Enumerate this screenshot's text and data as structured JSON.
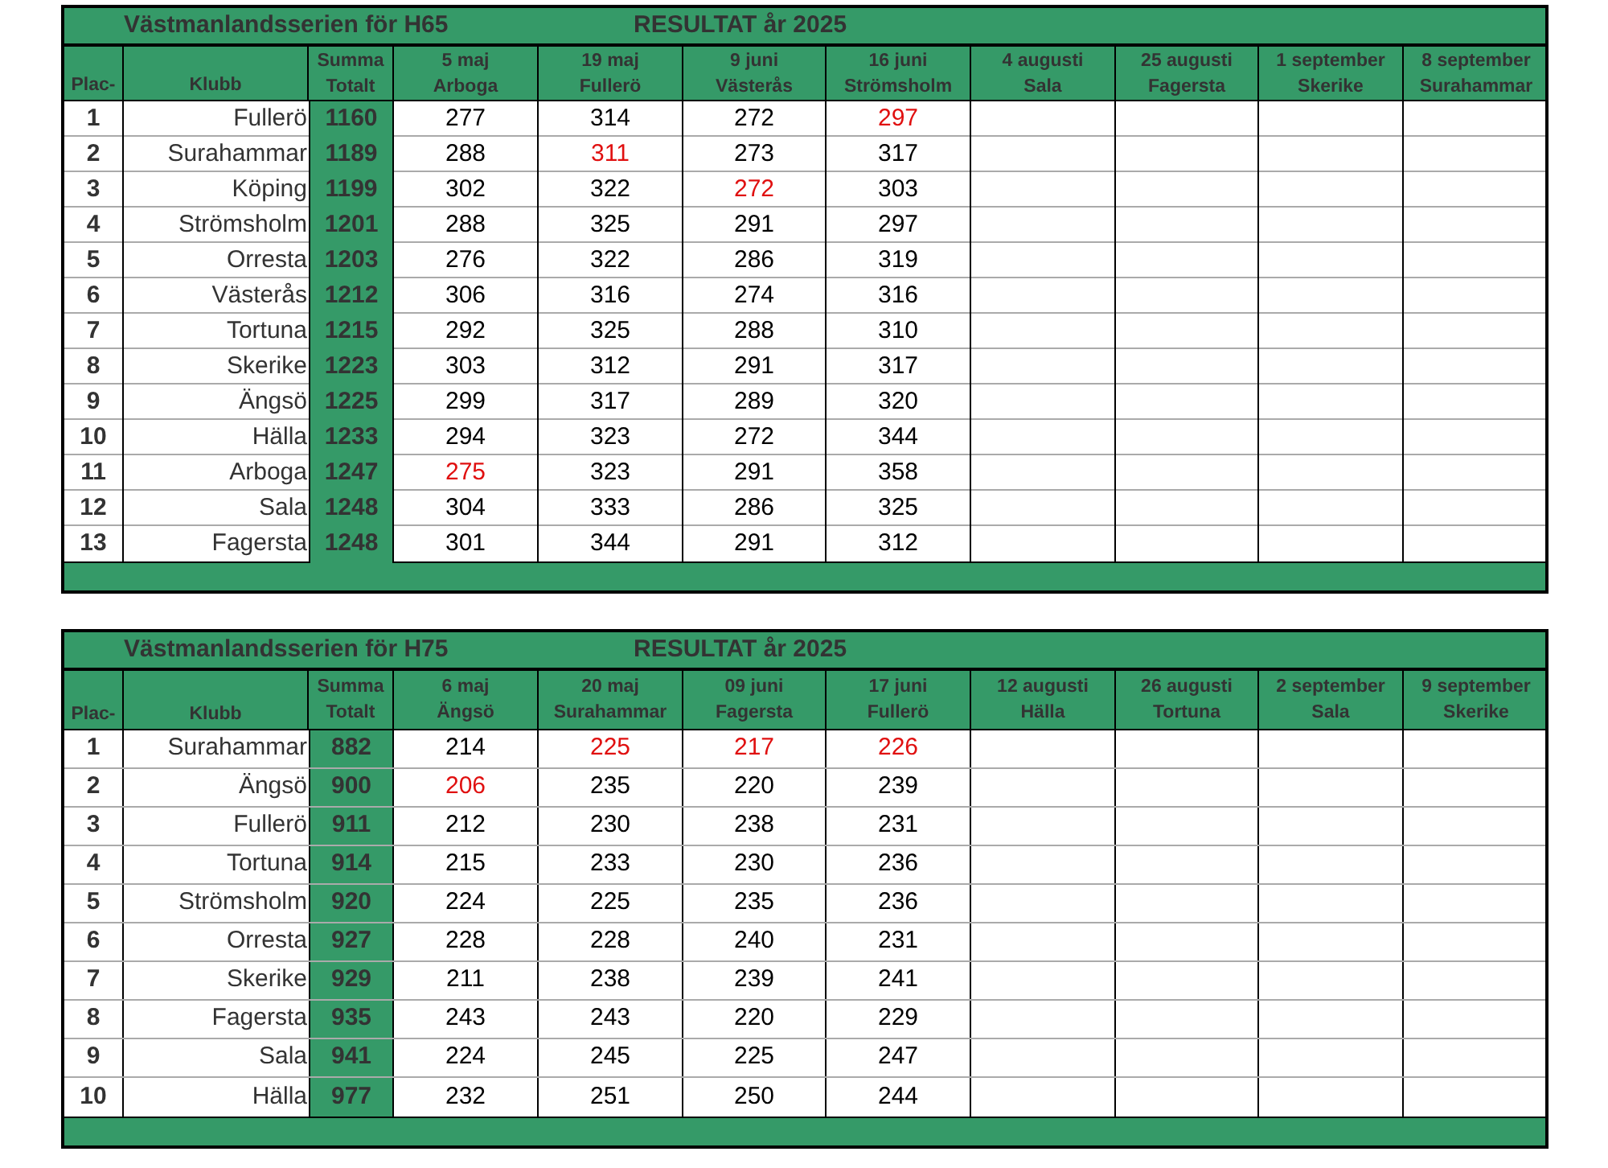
{
  "tables": [
    {
      "title": "Västmanlandsserien för H65",
      "subtitle": "RESULTAT år 2025",
      "place_header": "Plac-",
      "club_header": "Klubb",
      "total_header": [
        "Summa",
        "Totalt"
      ],
      "rounds": [
        {
          "date": "5 maj",
          "venue": "Arboga"
        },
        {
          "date": "19 maj",
          "venue": "Fullerö"
        },
        {
          "date": "9 juni",
          "venue": "Västerås"
        },
        {
          "date": "16 juni",
          "venue": "Strömsholm"
        },
        {
          "date": "4 augusti",
          "venue": "Sala"
        },
        {
          "date": "25 augusti",
          "venue": "Fagersta"
        },
        {
          "date": "1 september",
          "venue": "Skerike"
        },
        {
          "date": "8 september",
          "venue": "Surahammar"
        }
      ],
      "rows": [
        {
          "place": "1",
          "club": "Fullerö",
          "total": "1160",
          "scores": [
            {
              "value": "277",
              "marked": false
            },
            {
              "value": "314",
              "marked": false
            },
            {
              "value": "272",
              "marked": false
            },
            {
              "value": "297",
              "marked": true
            }
          ]
        },
        {
          "place": "2",
          "club": "Surahammar",
          "total": "1189",
          "scores": [
            {
              "value": "288",
              "marked": false
            },
            {
              "value": "311",
              "marked": true
            },
            {
              "value": "273",
              "marked": false
            },
            {
              "value": "317",
              "marked": false
            }
          ]
        },
        {
          "place": "3",
          "club": "Köping",
          "total": "1199",
          "scores": [
            {
              "value": "302",
              "marked": false
            },
            {
              "value": "322",
              "marked": false
            },
            {
              "value": "272",
              "marked": true
            },
            {
              "value": "303",
              "marked": false
            }
          ]
        },
        {
          "place": "4",
          "club": "Strömsholm",
          "total": "1201",
          "scores": [
            {
              "value": "288",
              "marked": false
            },
            {
              "value": "325",
              "marked": false
            },
            {
              "value": "291",
              "marked": false
            },
            {
              "value": "297",
              "marked": false
            }
          ]
        },
        {
          "place": "5",
          "club": "Orresta",
          "total": "1203",
          "scores": [
            {
              "value": "276",
              "marked": false
            },
            {
              "value": "322",
              "marked": false
            },
            {
              "value": "286",
              "marked": false
            },
            {
              "value": "319",
              "marked": false
            }
          ]
        },
        {
          "place": "6",
          "club": "Västerås",
          "total": "1212",
          "scores": [
            {
              "value": "306",
              "marked": false
            },
            {
              "value": "316",
              "marked": false
            },
            {
              "value": "274",
              "marked": false
            },
            {
              "value": "316",
              "marked": false
            }
          ]
        },
        {
          "place": "7",
          "club": "Tortuna",
          "total": "1215",
          "scores": [
            {
              "value": "292",
              "marked": false
            },
            {
              "value": "325",
              "marked": false
            },
            {
              "value": "288",
              "marked": false
            },
            {
              "value": "310",
              "marked": false
            }
          ]
        },
        {
          "place": "8",
          "club": "Skerike",
          "total": "1223",
          "scores": [
            {
              "value": "303",
              "marked": false
            },
            {
              "value": "312",
              "marked": false
            },
            {
              "value": "291",
              "marked": false
            },
            {
              "value": "317",
              "marked": false
            }
          ]
        },
        {
          "place": "9",
          "club": "Ängsö",
          "total": "1225",
          "scores": [
            {
              "value": "299",
              "marked": false
            },
            {
              "value": "317",
              "marked": false
            },
            {
              "value": "289",
              "marked": false
            },
            {
              "value": "320",
              "marked": false
            }
          ]
        },
        {
          "place": "10",
          "club": "Hälla",
          "total": "1233",
          "scores": [
            {
              "value": "294",
              "marked": false
            },
            {
              "value": "323",
              "marked": false
            },
            {
              "value": "272",
              "marked": false
            },
            {
              "value": "344",
              "marked": false
            }
          ]
        },
        {
          "place": "11",
          "club": "Arboga",
          "total": "1247",
          "scores": [
            {
              "value": "275",
              "marked": true
            },
            {
              "value": "323",
              "marked": false
            },
            {
              "value": "291",
              "marked": false
            },
            {
              "value": "358",
              "marked": false
            }
          ]
        },
        {
          "place": "12",
          "club": "Sala",
          "total": "1248",
          "scores": [
            {
              "value": "304",
              "marked": false
            },
            {
              "value": "333",
              "marked": false
            },
            {
              "value": "286",
              "marked": false
            },
            {
              "value": "325",
              "marked": false
            }
          ]
        },
        {
          "place": "13",
          "club": "Fagersta",
          "total": "1248",
          "scores": [
            {
              "value": "301",
              "marked": false
            },
            {
              "value": "344",
              "marked": false
            },
            {
              "value": "291",
              "marked": false
            },
            {
              "value": "312",
              "marked": false
            }
          ]
        }
      ]
    },
    {
      "title": "Västmanlandsserien för H75",
      "subtitle": "RESULTAT år 2025",
      "place_header": "Plac-",
      "club_header": "Klubb",
      "total_header": [
        "Summa",
        "Totalt"
      ],
      "rounds": [
        {
          "date": "6 maj",
          "venue": "Ängsö"
        },
        {
          "date": "20 maj",
          "venue": "Surahammar"
        },
        {
          "date": "09 juni",
          "venue": "Fagersta"
        },
        {
          "date": "17 juni",
          "venue": "Fullerö"
        },
        {
          "date": "12 augusti",
          "venue": "Hälla"
        },
        {
          "date": "26 augusti",
          "venue": "Tortuna"
        },
        {
          "date": "2 september",
          "venue": "Sala"
        },
        {
          "date": "9 september",
          "venue": "Skerike"
        }
      ],
      "rows": [
        {
          "place": "1",
          "club": "Surahammar",
          "total": "882",
          "scores": [
            {
              "value": "214",
              "marked": false
            },
            {
              "value": "225",
              "marked": true
            },
            {
              "value": "217",
              "marked": true
            },
            {
              "value": "226",
              "marked": true
            }
          ]
        },
        {
          "place": "2",
          "club": "Ängsö",
          "total": "900",
          "scores": [
            {
              "value": "206",
              "marked": true
            },
            {
              "value": "235",
              "marked": false
            },
            {
              "value": "220",
              "marked": false
            },
            {
              "value": "239",
              "marked": false
            }
          ]
        },
        {
          "place": "3",
          "club": "Fullerö",
          "total": "911",
          "scores": [
            {
              "value": "212",
              "marked": false
            },
            {
              "value": "230",
              "marked": false
            },
            {
              "value": "238",
              "marked": false
            },
            {
              "value": "231",
              "marked": false
            }
          ]
        },
        {
          "place": "4",
          "club": "Tortuna",
          "total": "914",
          "scores": [
            {
              "value": "215",
              "marked": false
            },
            {
              "value": "233",
              "marked": false
            },
            {
              "value": "230",
              "marked": false
            },
            {
              "value": "236",
              "marked": false
            }
          ]
        },
        {
          "place": "5",
          "club": "Strömsholm",
          "total": "920",
          "scores": [
            {
              "value": "224",
              "marked": false
            },
            {
              "value": "225",
              "marked": false
            },
            {
              "value": "235",
              "marked": false
            },
            {
              "value": "236",
              "marked": false
            }
          ]
        },
        {
          "place": "6",
          "club": "Orresta",
          "total": "927",
          "scores": [
            {
              "value": "228",
              "marked": false
            },
            {
              "value": "228",
              "marked": false
            },
            {
              "value": "240",
              "marked": false
            },
            {
              "value": "231",
              "marked": false
            }
          ]
        },
        {
          "place": "7",
          "club": "Skerike",
          "total": "929",
          "scores": [
            {
              "value": "211",
              "marked": false
            },
            {
              "value": "238",
              "marked": false
            },
            {
              "value": "239",
              "marked": false
            },
            {
              "value": "241",
              "marked": false
            }
          ]
        },
        {
          "place": "8",
          "club": "Fagersta",
          "total": "935",
          "scores": [
            {
              "value": "243",
              "marked": false
            },
            {
              "value": "243",
              "marked": false
            },
            {
              "value": "220",
              "marked": false
            },
            {
              "value": "229",
              "marked": false
            }
          ]
        },
        {
          "place": "9",
          "club": "Sala",
          "total": "941",
          "scores": [
            {
              "value": "224",
              "marked": false
            },
            {
              "value": "245",
              "marked": false
            },
            {
              "value": "225",
              "marked": false
            },
            {
              "value": "247",
              "marked": false
            }
          ]
        },
        {
          "place": "10",
          "club": "Hälla",
          "total": "977",
          "scores": [
            {
              "value": "232",
              "marked": false
            },
            {
              "value": "251",
              "marked": false
            },
            {
              "value": "250",
              "marked": false
            },
            {
              "value": "244",
              "marked": false
            }
          ]
        }
      ]
    }
  ]
}
